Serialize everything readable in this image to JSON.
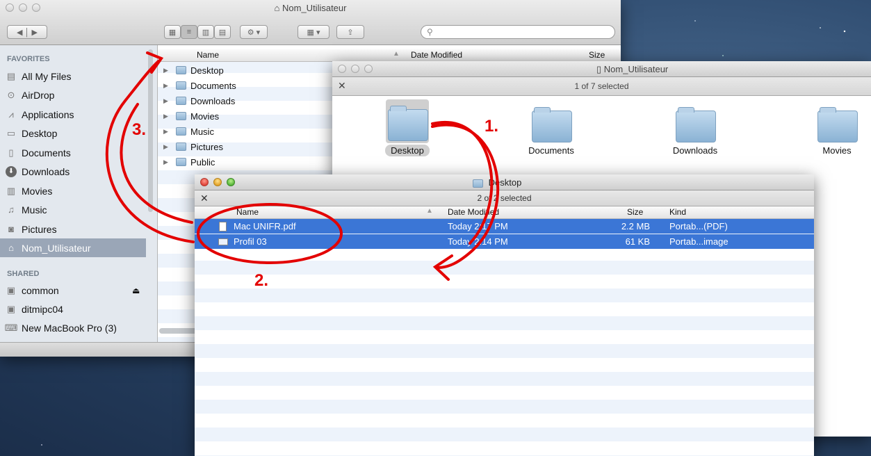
{
  "finder_main": {
    "title": "Nom_Utilisateur",
    "search_placeholder": "",
    "sidebar": {
      "favorites_header": "FAVORITES",
      "favorites": [
        {
          "label": "All My Files",
          "icon": "all-files-icon"
        },
        {
          "label": "AirDrop",
          "icon": "airdrop-icon"
        },
        {
          "label": "Applications",
          "icon": "applications-icon"
        },
        {
          "label": "Desktop",
          "icon": "desktop-icon"
        },
        {
          "label": "Documents",
          "icon": "documents-icon"
        },
        {
          "label": "Downloads",
          "icon": "downloads-icon"
        },
        {
          "label": "Movies",
          "icon": "movies-icon"
        },
        {
          "label": "Music",
          "icon": "music-icon"
        },
        {
          "label": "Pictures",
          "icon": "pictures-icon"
        },
        {
          "label": "Nom_Utilisateur",
          "icon": "home-icon",
          "selected": true
        }
      ],
      "shared_header": "SHARED",
      "shared": [
        {
          "label": "common",
          "icon": "server-icon"
        },
        {
          "label": "ditmipc04",
          "icon": "server-icon"
        },
        {
          "label": "New MacBook Pro (3)",
          "icon": "computer-icon"
        }
      ]
    },
    "columns": {
      "name": "Name",
      "date": "Date Modified",
      "size": "Size"
    },
    "rows": [
      "Desktop",
      "Documents",
      "Downloads",
      "Movies",
      "Music",
      "Pictures",
      "Public"
    ]
  },
  "finder_icon": {
    "title": "Nom_Utilisateur",
    "status": "1 of 7 selected",
    "items": [
      "Desktop",
      "Documents",
      "Downloads",
      "Movies"
    ]
  },
  "finder_desktop": {
    "title": "Desktop",
    "status": "2 of 2 selected",
    "columns": {
      "name": "Name",
      "date": "Date Modified",
      "size": "Size",
      "kind": "Kind"
    },
    "files": [
      {
        "name": "Mac UNIFR.pdf",
        "date": "Today 2:17 PM",
        "size": "2.2 MB",
        "kind": "Portab...(PDF)"
      },
      {
        "name": "Profil 03",
        "date": "Today 2:14 PM",
        "size": "61 KB",
        "kind": "Portab...image"
      }
    ]
  },
  "annotations": {
    "step1": "1.",
    "step2": "2.",
    "step3": "3."
  },
  "colors": {
    "accent": "#3b76d6",
    "annotation": "#e30000"
  }
}
